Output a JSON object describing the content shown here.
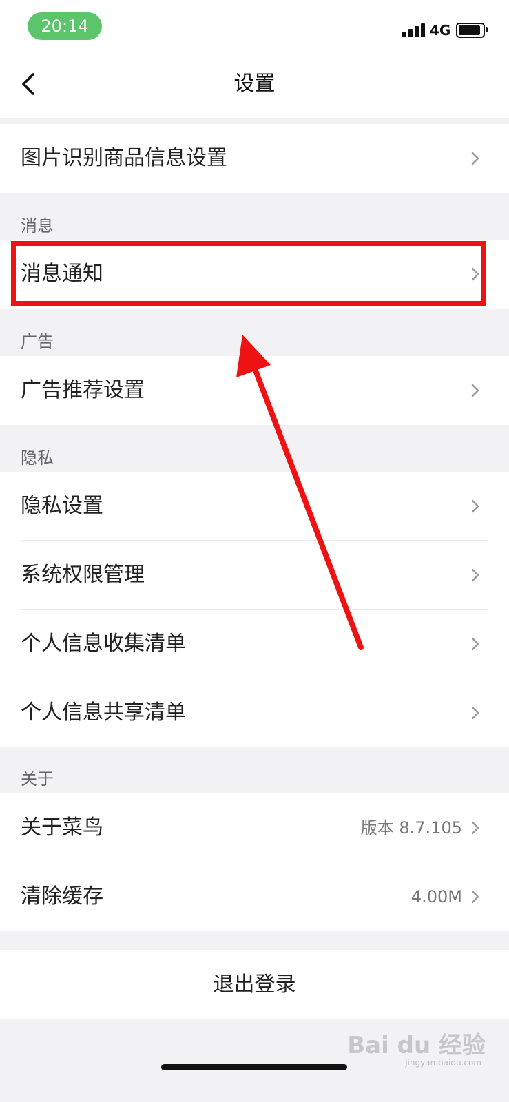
{
  "status_bar": {
    "time": "20:14",
    "network": "4G"
  },
  "nav": {
    "title": "设置",
    "back_icon": "chevron-left-icon"
  },
  "groups": {
    "top": {
      "items": [
        {
          "label": "图片识别商品信息设置"
        }
      ]
    },
    "message": {
      "header": "消息",
      "items": [
        {
          "label": "消息通知"
        }
      ]
    },
    "ads": {
      "header": "广告",
      "items": [
        {
          "label": "广告推荐设置"
        }
      ]
    },
    "privacy": {
      "header": "隐私",
      "items": [
        {
          "label": "隐私设置"
        },
        {
          "label": "系统权限管理"
        },
        {
          "label": "个人信息收集清单"
        },
        {
          "label": "个人信息共享清单"
        }
      ]
    },
    "about": {
      "header": "关于",
      "items": [
        {
          "label": "关于菜鸟",
          "value": "版本 8.7.105"
        },
        {
          "label": "清除缓存",
          "value": "4.00M"
        }
      ]
    }
  },
  "logout": {
    "label": "退出登录"
  },
  "watermark": {
    "text": "Bai du 经验",
    "sub": "jingyan.baidu.com"
  },
  "colors": {
    "accent_green": "#5cc56b",
    "annotation_red": "#ee1212",
    "background": "#f2f2f4"
  }
}
